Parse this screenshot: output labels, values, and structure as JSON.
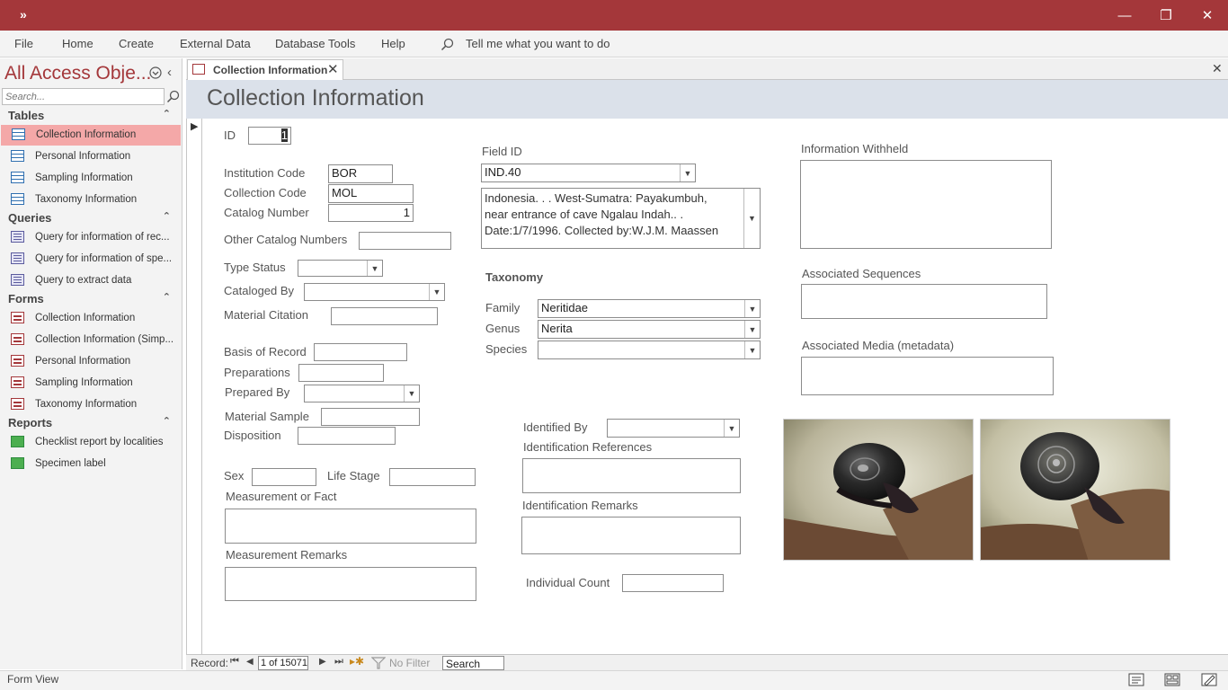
{
  "titlebar": {
    "qat_glyph": "»",
    "minimize": "—",
    "restore": "❐",
    "close": "✕"
  },
  "ribbon": {
    "tabs": [
      "File",
      "Home",
      "Create",
      "External Data",
      "Database Tools",
      "Help"
    ],
    "tell_me": "Tell me what you want to do"
  },
  "nav": {
    "title": "All Access Obje...",
    "search_placeholder": "Search...",
    "sections": [
      {
        "label": "Tables",
        "items": [
          "Collection Information",
          "Personal Information",
          "Sampling Information",
          "Taxonomy Information"
        ]
      },
      {
        "label": "Queries",
        "items": [
          "Query for information of rec...",
          "Query for information of spe...",
          "Query to extract data"
        ]
      },
      {
        "label": "Forms",
        "items": [
          "Collection Information",
          "Collection Information (Simp...",
          "Personal Information",
          "Sampling Information",
          "Taxonomy Information"
        ]
      },
      {
        "label": "Reports",
        "items": [
          "Checklist report by localities",
          "Specimen label"
        ]
      }
    ]
  },
  "document": {
    "tab_label": "Collection Information",
    "title": "Collection Information"
  },
  "form": {
    "id": {
      "label": "ID",
      "value": "1"
    },
    "institution_code": {
      "label": "Institution Code",
      "value": "BOR"
    },
    "collection_code": {
      "label": "Collection Code",
      "value": "MOL"
    },
    "catalog_number": {
      "label": "Catalog Number",
      "value": "1"
    },
    "other_catalog_numbers": {
      "label": "Other Catalog Numbers",
      "value": ""
    },
    "type_status": {
      "label": "Type Status",
      "value": ""
    },
    "cataloged_by": {
      "label": "Cataloged By",
      "value": ""
    },
    "material_citation": {
      "label": "Material Citation",
      "value": ""
    },
    "basis_of_record": {
      "label": "Basis of Record",
      "value": ""
    },
    "preparations": {
      "label": "Preparations",
      "value": ""
    },
    "prepared_by": {
      "label": "Prepared By",
      "value": ""
    },
    "material_sample": {
      "label": "Material Sample",
      "value": ""
    },
    "disposition": {
      "label": "Disposition",
      "value": ""
    },
    "sex": {
      "label": "Sex",
      "value": ""
    },
    "life_stage": {
      "label": "Life Stage",
      "value": ""
    },
    "measurement_or_fact": {
      "label": "Measurement or Fact",
      "value": ""
    },
    "measurement_remarks": {
      "label": "Measurement Remarks",
      "value": ""
    },
    "field_id": {
      "label": "Field ID",
      "value": "IND.40"
    },
    "locality_memo": [
      "Indonesia. . . West-Sumatra: Payakumbuh,",
      "near entrance of cave Ngalau Indah.. .",
      "Date:1/7/1996. Collected by:W.J.M. Maassen"
    ],
    "taxonomy_heading": "Taxonomy",
    "family": {
      "label": "Family",
      "value": "Neritidae"
    },
    "genus": {
      "label": "Genus",
      "value": "Nerita"
    },
    "species": {
      "label": "Species",
      "value": ""
    },
    "identified_by": {
      "label": "Identified By",
      "value": ""
    },
    "identification_references": {
      "label": "Identification References",
      "value": ""
    },
    "identification_remarks": {
      "label": "Identification Remarks",
      "value": ""
    },
    "individual_count": {
      "label": "Individual Count",
      "value": ""
    },
    "information_withheld": {
      "label": "Information Withheld",
      "value": ""
    },
    "associated_sequences": {
      "label": "Associated Sequences",
      "value": ""
    },
    "associated_media": {
      "label": "Associated Media (metadata)",
      "value": ""
    }
  },
  "record_nav": {
    "label": "Record:",
    "position": "1 of 15071",
    "filter": "No Filter",
    "search": "Search"
  },
  "status": {
    "view": "Form View"
  },
  "colors": {
    "accent": "#a4373a",
    "header_band": "#dbe1ea",
    "selected_item": "#f4a8a8"
  }
}
